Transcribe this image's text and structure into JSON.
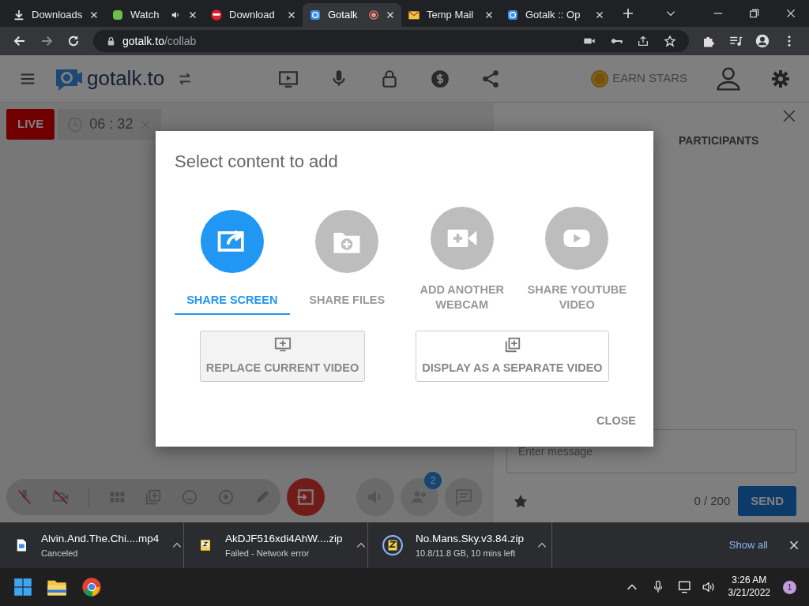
{
  "browser_tabs": [
    {
      "title": "Downloads",
      "kind": "download",
      "selected": false,
      "audio": false,
      "recording": false
    },
    {
      "title": "Watch",
      "kind": "green",
      "selected": false,
      "audio": true,
      "recording": false
    },
    {
      "title": "Download",
      "kind": "red",
      "selected": false,
      "audio": false,
      "recording": false
    },
    {
      "title": "Gotalk",
      "kind": "gotalk",
      "selected": true,
      "audio": false,
      "recording": true
    },
    {
      "title": "Temp Mail",
      "kind": "mail",
      "selected": false,
      "audio": false,
      "recording": false
    },
    {
      "title": "Gotalk :: Op",
      "kind": "gotalk",
      "selected": false,
      "audio": false,
      "recording": false
    }
  ],
  "address_bar": {
    "host": "gotalk.to",
    "path": "/collab"
  },
  "app_header": {
    "logo": "gotalk.to",
    "earn_stars": "EARN STARS"
  },
  "live_bar": {
    "live": "LIVE",
    "timer": "06 : 32"
  },
  "dialog": {
    "title": "Select content to add",
    "options": [
      {
        "label": "SHARE SCREEN",
        "kind": "screen",
        "selected": true
      },
      {
        "label": "SHARE FILES",
        "kind": "files",
        "selected": false
      },
      {
        "label": "ADD ANOTHER WEBCAM",
        "kind": "webcam",
        "selected": false
      },
      {
        "label": "SHARE YOUTUBE VIDEO",
        "kind": "youtube",
        "selected": false
      }
    ],
    "actions": [
      {
        "label": "REPLACE CURRENT VIDEO",
        "kind": "replace",
        "hovered": true
      },
      {
        "label": "DISPLAY AS A SEPARATE VIDEO",
        "kind": "separate",
        "hovered": false
      }
    ],
    "close": "CLOSE"
  },
  "controls": {
    "participants_badge": "2"
  },
  "chat_panel": {
    "title": "PARTICIPANTS",
    "placeholder": "Enter message",
    "count": "0 / 200",
    "send": "SEND"
  },
  "downloads": [
    {
      "name": "Alvin.And.The.Chi....mp4",
      "status": "Canceled",
      "kind": "video"
    },
    {
      "name": "AkDJF516xdi4AhW....zip",
      "status": "Failed - Network error",
      "kind": "zip"
    },
    {
      "name": "No.Mans.Sky.v3.84.zip",
      "status": "10.8/11.8 GB, 10 mins left",
      "kind": "progress"
    }
  ],
  "show_all": "Show all",
  "taskbar": {
    "time": "3:26 AM",
    "date": "3/21/2022",
    "notifications": "1"
  }
}
